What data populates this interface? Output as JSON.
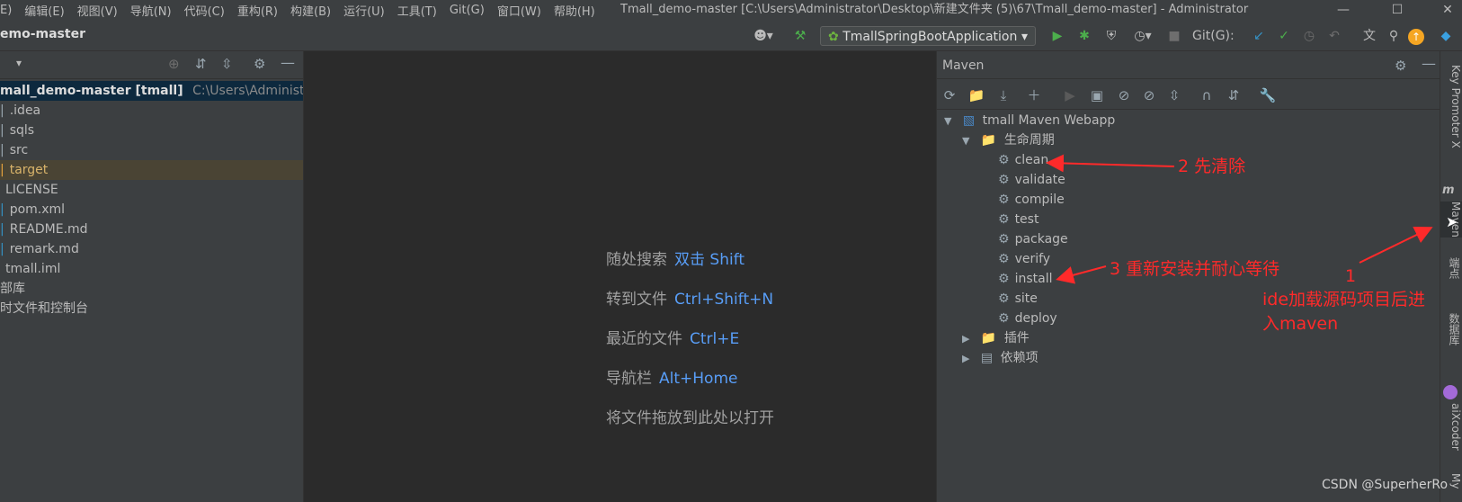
{
  "window": {
    "title": "Tmall_demo-master [C:\\Users\\Administrator\\Desktop\\新建文件夹 (5)\\67\\Tmall_demo-master] - Administrator"
  },
  "menu": [
    "E)",
    "编辑(E)",
    "视图(V)",
    "导航(N)",
    "代码(C)",
    "重构(R)",
    "构建(B)",
    "运行(U)",
    "工具(T)",
    "Git(G)",
    "窗口(W)",
    "帮助(H)"
  ],
  "toolbar": {
    "project_name": "emo-master",
    "run_config": "TmallSpringBootApplication",
    "git_label": "Git(G):"
  },
  "project": {
    "rows": [
      {
        "name": "mall_demo-master [tmall]",
        "path": "C:\\Users\\Administrator\\De"
      },
      {
        "name": ".idea",
        "path": ""
      },
      {
        "name": "sqls",
        "path": ""
      },
      {
        "name": "src",
        "path": ""
      },
      {
        "name": "target",
        "path": ""
      },
      {
        "name": "LICENSE",
        "path": ""
      },
      {
        "name": "pom.xml",
        "path": ""
      },
      {
        "name": "README.md",
        "path": ""
      },
      {
        "name": "remark.md",
        "path": ""
      },
      {
        "name": "tmall.iml",
        "path": ""
      },
      {
        "name": "部库",
        "path": ""
      },
      {
        "name": "时文件和控制台",
        "path": ""
      }
    ]
  },
  "editor": {
    "hints": [
      {
        "label": "随处搜索",
        "key": "双击 Shift"
      },
      {
        "label": "转到文件",
        "key": "Ctrl+Shift+N"
      },
      {
        "label": "最近的文件",
        "key": "Ctrl+E"
      },
      {
        "label": "导航栏",
        "key": "Alt+Home"
      },
      {
        "label": "将文件拖放到此处以打开",
        "key": ""
      }
    ]
  },
  "maven": {
    "title": "Maven",
    "root": "tmall Maven Webapp",
    "lifecycle_label": "生命周期",
    "lifecycle": [
      "clean",
      "validate",
      "compile",
      "test",
      "package",
      "verify",
      "install",
      "site",
      "deploy"
    ],
    "plugins_label": "插件",
    "deps_label": "依赖项"
  },
  "annotations": {
    "a2": "2 先清除",
    "a3": "3 重新安装并耐心等待",
    "a1_num": "1",
    "a1_line1": "ide加载源码项目后进",
    "a1_line2": "入maven"
  },
  "stripe": [
    "Key Promoter X",
    "Maven",
    "端点",
    "数据库",
    "aiXcoder",
    "My"
  ],
  "watermark": "CSDN @SuperherRo"
}
